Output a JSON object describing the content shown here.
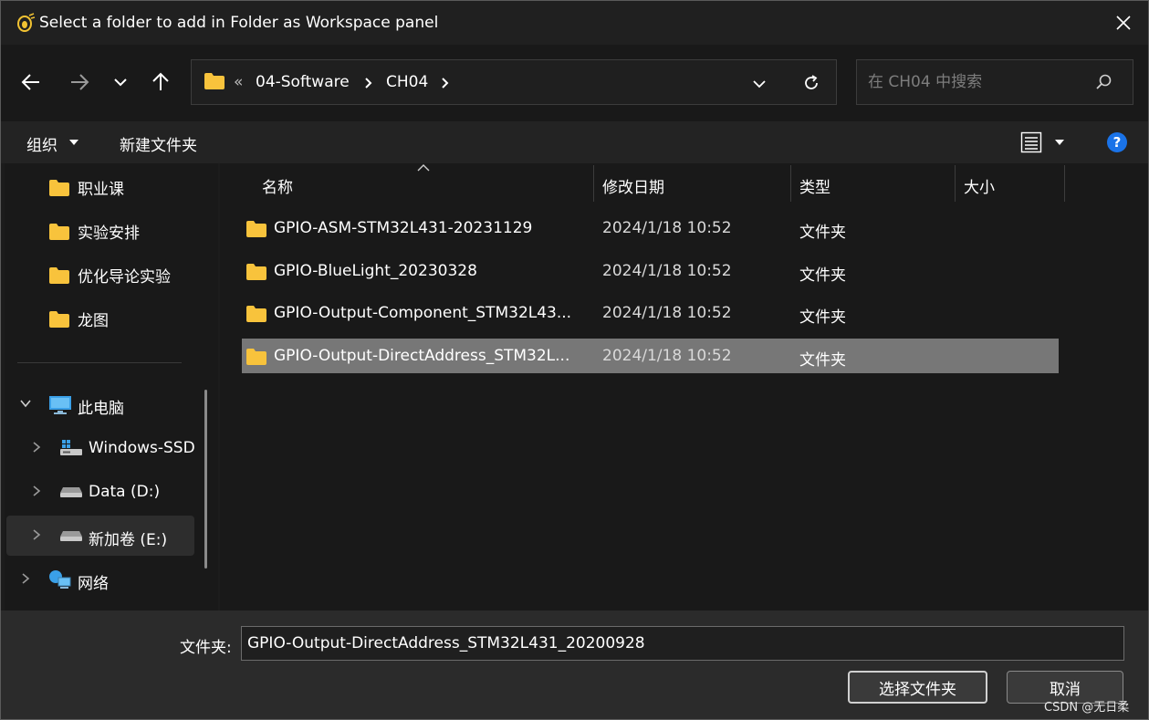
{
  "window": {
    "title": "Select a folder to add in Folder as Workspace panel",
    "app_icon": "app-bug-icon",
    "close_icon": "close-icon"
  },
  "nav": {
    "back_icon": "arrow-left-icon",
    "forward_icon": "arrow-right-icon",
    "recent_icon": "chevron-down-icon",
    "up_icon": "arrow-up-icon",
    "address": {
      "overflow": "«",
      "crumbs": [
        "04-Software",
        "CH04"
      ]
    },
    "refresh_icon": "refresh-icon",
    "search": {
      "placeholder": "在 CH04 中搜索",
      "value": ""
    }
  },
  "commands": {
    "organize": "组织",
    "new_folder": "新建文件夹",
    "view_icon": "details-view-icon",
    "help_icon": "help-icon"
  },
  "sidebar": {
    "quick_access": [
      "职业课",
      "实验安排",
      "优化导论实验",
      "龙图"
    ],
    "this_pc": "此电脑",
    "drives": [
      "Windows-SSD",
      "Data (D:)",
      "新加卷 (E:)"
    ],
    "network": "网络"
  },
  "list": {
    "columns": [
      "名称",
      "修改日期",
      "类型",
      "大小"
    ],
    "rows": [
      {
        "name": "GPIO-ASM-STM32L431-20231129",
        "date": "2024/1/18 10:52",
        "type": "文件夹",
        "size": ""
      },
      {
        "name": "GPIO-BlueLight_20230328",
        "date": "2024/1/18 10:52",
        "type": "文件夹",
        "size": ""
      },
      {
        "name": "GPIO-Output-Component_STM32L43...",
        "date": "2024/1/18 10:52",
        "type": "文件夹",
        "size": ""
      },
      {
        "name": "GPIO-Output-DirectAddress_STM32L...",
        "date": "2024/1/18 10:52",
        "type": "文件夹",
        "size": ""
      }
    ]
  },
  "footer": {
    "folder_label": "文件夹:",
    "folder_value": "GPIO-Output-DirectAddress_STM32L431_20200928",
    "select_button": "选择文件夹",
    "cancel_button": "取消"
  },
  "watermark": "CSDN @无日柔",
  "colors": {
    "folder": "#f8c33c",
    "selected_row": "#777777",
    "help_blue": "#1a73e8"
  }
}
